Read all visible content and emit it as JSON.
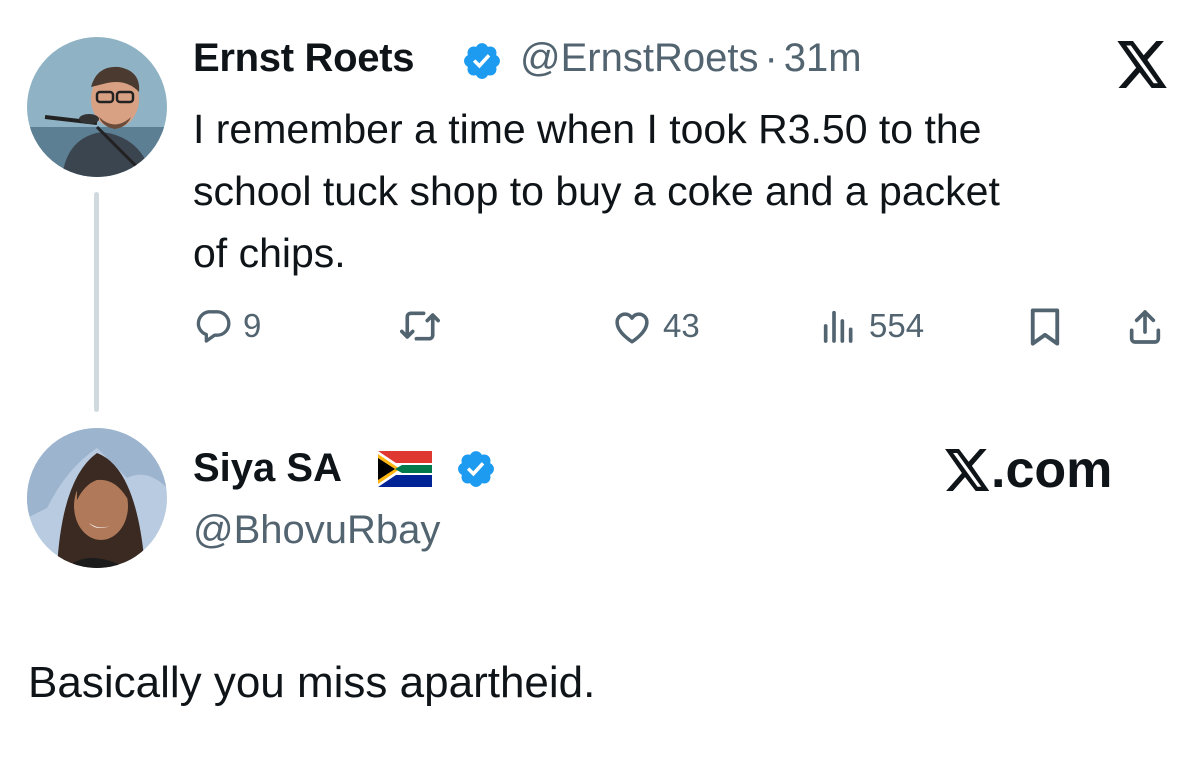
{
  "tweet": {
    "author_name": "Ernst Roets",
    "handle": "@ErnstRoets",
    "separator": "·",
    "time": "31m",
    "text": "I remember a time when I took R3.50 to the\nschool tuck shop to buy a coke and a packet\nof chips.",
    "actions": {
      "replies": "9",
      "reposts": "",
      "likes": "43",
      "views": "554"
    },
    "icons": [
      "verified-badge-icon",
      "x-logo-icon",
      "reply-icon",
      "repost-icon",
      "like-icon",
      "views-icon",
      "bookmark-icon",
      "share-icon"
    ]
  },
  "reply": {
    "author_name": "Siya SA",
    "flag": "south-africa-flag-icon",
    "handle": "@BhovuRbay",
    "brand": ".com",
    "text": "Basically you miss apartheid."
  },
  "colors": {
    "text": "#0f1419",
    "secondary": "#536471",
    "verified": "#1d9bf0",
    "thread_line": "#cfd9de"
  }
}
